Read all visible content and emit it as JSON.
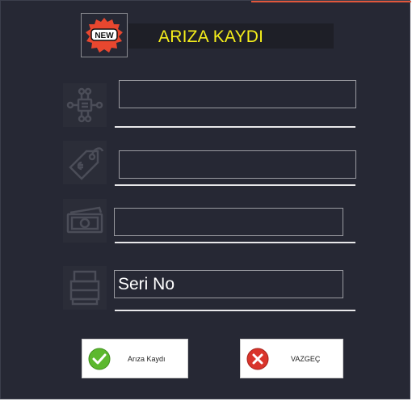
{
  "header": {
    "title": "ARIZA KAYDI",
    "badge_text": "NEW",
    "badge_icon": "new-badge-icon"
  },
  "fields": [
    {
      "icon": "network-icon",
      "value": "",
      "placeholder": ""
    },
    {
      "icon": "price-tag-icon",
      "value": "",
      "placeholder": ""
    },
    {
      "icon": "banknote-icon",
      "value": "",
      "placeholder": ""
    },
    {
      "icon": "device-box-icon",
      "value": "Seri No",
      "placeholder": ""
    }
  ],
  "buttons": {
    "save_label": "Arıza Kaydı",
    "save_icon": "check-icon",
    "cancel_label": "VAZGEÇ",
    "cancel_icon": "cancel-icon"
  },
  "colors": {
    "background": "#262834",
    "title": "#f5ee1b",
    "accent": "#e1573c",
    "check": "#5cb82e",
    "cancel": "#d9342b"
  }
}
